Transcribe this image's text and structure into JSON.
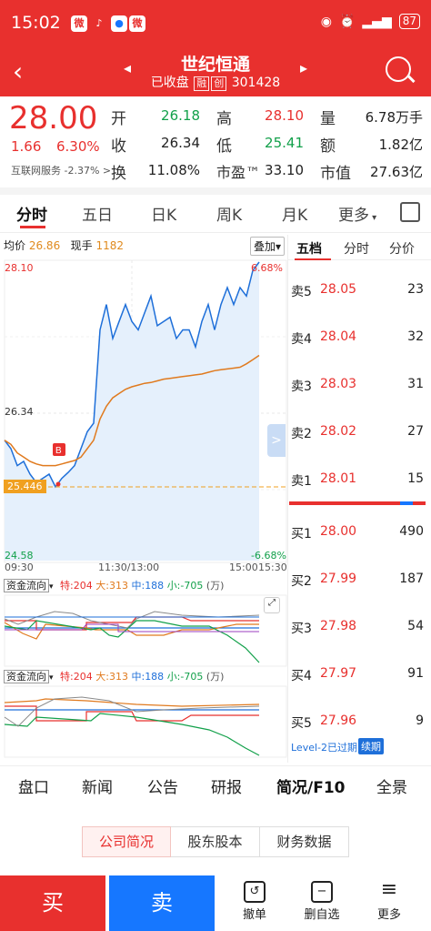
{
  "status": {
    "time": "15:02",
    "battery": "87"
  },
  "nav": {
    "title": "世纪恒通",
    "status": "已收盘",
    "tag1": "融",
    "tag2": "创",
    "code": "301428"
  },
  "quote": {
    "price": "28.00",
    "change": "1.66",
    "pct": "6.30%",
    "sector": "互联网服务 -2.37% >",
    "open_l": "开",
    "open": "26.18",
    "high_l": "高",
    "high": "28.10",
    "vol_l": "量",
    "vol": "6.78万手",
    "prev_l": "收",
    "prev": "26.34",
    "low_l": "低",
    "low": "25.41",
    "amt_l": "额",
    "amt": "1.82亿",
    "turn_l": "换",
    "turn": "11.08%",
    "pe_l": "市盈™",
    "pe": "33.10",
    "cap_l": "市值",
    "cap": "27.63亿"
  },
  "tabs": [
    "分时",
    "五日",
    "日K",
    "周K",
    "月K",
    "更多"
  ],
  "chart_info": {
    "avg_l": "均价",
    "avg": "26.86",
    "now_l": "现手",
    "now": "1182",
    "overlay": "叠加"
  },
  "chart_data": {
    "type": "line",
    "title": "",
    "y_top": "28.10",
    "y_mid": "26.34",
    "y_bot": "24.58",
    "pct_top": "6.68%",
    "pct_bot": "-6.68%",
    "ref_price": "25.446",
    "x_labels": [
      "09:30",
      "11:30/13:00",
      "15:00",
      "15:30"
    ],
    "series": [
      {
        "values": [
          26.0,
          25.9,
          25.7,
          25.75,
          25.6,
          25.5,
          25.55,
          25.6,
          25.45,
          25.55,
          25.62,
          25.7,
          25.9,
          26.1,
          26.2,
          27.3,
          27.6,
          27.2,
          27.4,
          27.6,
          27.4,
          27.3,
          27.5,
          27.7,
          27.35,
          27.4,
          27.45,
          27.2,
          27.3,
          27.3,
          27.1,
          27.4,
          27.6,
          27.3,
          27.6,
          27.8,
          27.6,
          27.8,
          27.7,
          28.0,
          28.1
        ]
      },
      {
        "values": [
          26.0,
          25.95,
          25.85,
          25.8,
          25.75,
          25.72,
          25.7,
          25.7,
          25.7,
          25.72,
          25.74,
          25.76,
          25.8,
          25.9,
          26.0,
          26.25,
          26.4,
          26.5,
          26.55,
          26.6,
          26.63,
          26.65,
          26.67,
          26.68,
          26.7,
          26.72,
          26.73,
          26.74,
          26.75,
          26.76,
          26.77,
          26.78,
          26.8,
          26.82,
          26.83,
          26.84,
          26.85,
          26.86,
          26.9,
          26.95,
          27.0
        ]
      }
    ]
  },
  "flow": [
    {
      "label": "资金流向",
      "special_l": "特:",
      "special": "204",
      "big_l": "大:",
      "big": "313",
      "mid_l": "中:",
      "mid": "188",
      "small_l": "小:",
      "small": "-705",
      "unit": "(万)"
    },
    {
      "label": "资金流向",
      "special_l": "特:",
      "special": "204",
      "big_l": "大:",
      "big": "313",
      "mid_l": "中:",
      "mid": "188",
      "small_l": "小:",
      "small": "-705",
      "unit": "(万)"
    }
  ],
  "book": {
    "tabs": [
      "五档",
      "分时",
      "分价"
    ],
    "asks": [
      {
        "l": "卖5",
        "p": "28.05",
        "v": "23"
      },
      {
        "l": "卖4",
        "p": "28.04",
        "v": "32"
      },
      {
        "l": "卖3",
        "p": "28.03",
        "v": "31"
      },
      {
        "l": "卖2",
        "p": "28.02",
        "v": "27"
      },
      {
        "l": "卖1",
        "p": "28.01",
        "v": "15"
      }
    ],
    "bids": [
      {
        "l": "买1",
        "p": "28.00",
        "v": "490"
      },
      {
        "l": "买2",
        "p": "27.99",
        "v": "187"
      },
      {
        "l": "买3",
        "p": "27.98",
        "v": "54"
      },
      {
        "l": "买4",
        "p": "27.97",
        "v": "91"
      },
      {
        "l": "买5",
        "p": "27.96",
        "v": "9"
      }
    ],
    "level2": "Level-2已过期",
    "renew": "续期"
  },
  "bottom_tabs": [
    "盘口",
    "新闻",
    "公告",
    "研报",
    "简况/F10",
    "全景"
  ],
  "seg": [
    "公司简况",
    "股东股本",
    "财务数据"
  ],
  "actions": {
    "buy": "买",
    "sell": "卖",
    "cancel": "撤单",
    "del": "删自选",
    "more": "更多"
  }
}
